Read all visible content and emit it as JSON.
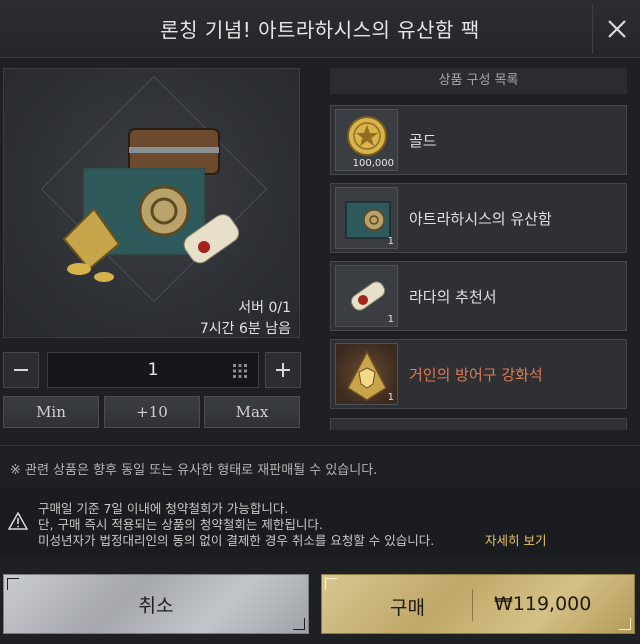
{
  "header": {
    "title": "론칭 기념! 아트라하시스의 유산함 팩",
    "close_icon": "close-icon"
  },
  "preview": {
    "server_limit": "서버 0/1",
    "time_remaining": "7시간 6분 남음"
  },
  "quantity": {
    "value": "1",
    "minus_icon": "minus-icon",
    "plus_icon": "plus-icon",
    "keypad_icon": "keypad-icon",
    "presets": [
      "Min",
      "+10",
      "Max"
    ]
  },
  "contents": {
    "header": "상품 구성 목록",
    "items": [
      {
        "name": "골드",
        "count": "100,000",
        "icon": "gold-coin-icon"
      },
      {
        "name": "아트라하시스의 유산함",
        "count": "1",
        "icon": "legacy-chest-icon"
      },
      {
        "name": "라다의 추천서",
        "count": "1",
        "icon": "scroll-icon"
      },
      {
        "name": "거인의 방어구 강화석",
        "count": "1",
        "icon": "shield-stone-icon",
        "color": "#e07a52"
      }
    ]
  },
  "notice": "※ 관련 상품은 향후 동일 또는 유사한 형태로 재판매될 수 있습니다.",
  "warning": {
    "icon": "warning-icon",
    "lines": [
      "구매일 기준 7일 이내에 청약철회가 가능합니다.",
      "단, 구매 즉시 적용되는 상품의 청약철회는 제한됩니다.",
      "미성년자가 법정대리인의 동의 없이 결제한 경우 취소를 요청할 수 있습니다."
    ],
    "detail_link": "자세히 보기"
  },
  "footer": {
    "cancel_label": "취소",
    "buy_label": "구매",
    "price": "₩119,000"
  },
  "colors": {
    "accent_gold": "#e8c56a",
    "highlight_orange": "#e07a52",
    "buy_gold": "#c9b577",
    "cancel_silver": "#b8bbc0"
  }
}
